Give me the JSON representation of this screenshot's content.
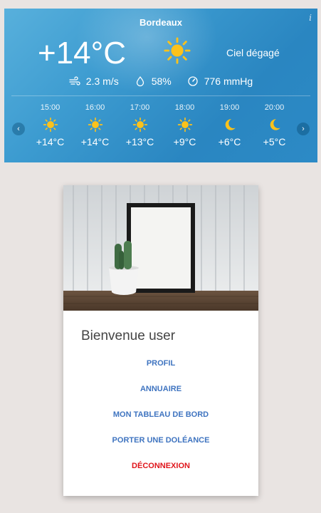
{
  "weather": {
    "city": "Bordeaux",
    "info": "i",
    "temperature": "+14°C",
    "condition": "Ciel dégagé",
    "wind": "2.3 m/s",
    "humidity": "58%",
    "pressure": "776 mmHg",
    "hourly": [
      {
        "time": "15:00",
        "icon": "sun-icon",
        "temp": "+14°C"
      },
      {
        "time": "16:00",
        "icon": "sun-icon",
        "temp": "+14°C"
      },
      {
        "time": "17:00",
        "icon": "sun-icon",
        "temp": "+13°C"
      },
      {
        "time": "18:00",
        "icon": "sun-icon",
        "temp": "+9°C"
      },
      {
        "time": "19:00",
        "icon": "moon-icon",
        "temp": "+6°C"
      },
      {
        "time": "20:00",
        "icon": "moon-icon",
        "temp": "+5°C"
      }
    ],
    "prev": "‹",
    "next": "›"
  },
  "card": {
    "image": "cactus-frame-photo",
    "welcome": "Bienvenue user",
    "menu": {
      "profil": "PROFIL",
      "annuaire": "ANNUAIRE",
      "dashboard": "MON TABLEAU DE BORD",
      "doleance": "PORTER UNE DOLÉANCE",
      "logout": "DÉCONNEXION"
    }
  },
  "colors": {
    "weather_bg": "#3c9bd0",
    "sun": "#fcc21b",
    "link": "#3f74c0",
    "logout": "#e0151b",
    "page_bg": "#e9e4e2"
  }
}
